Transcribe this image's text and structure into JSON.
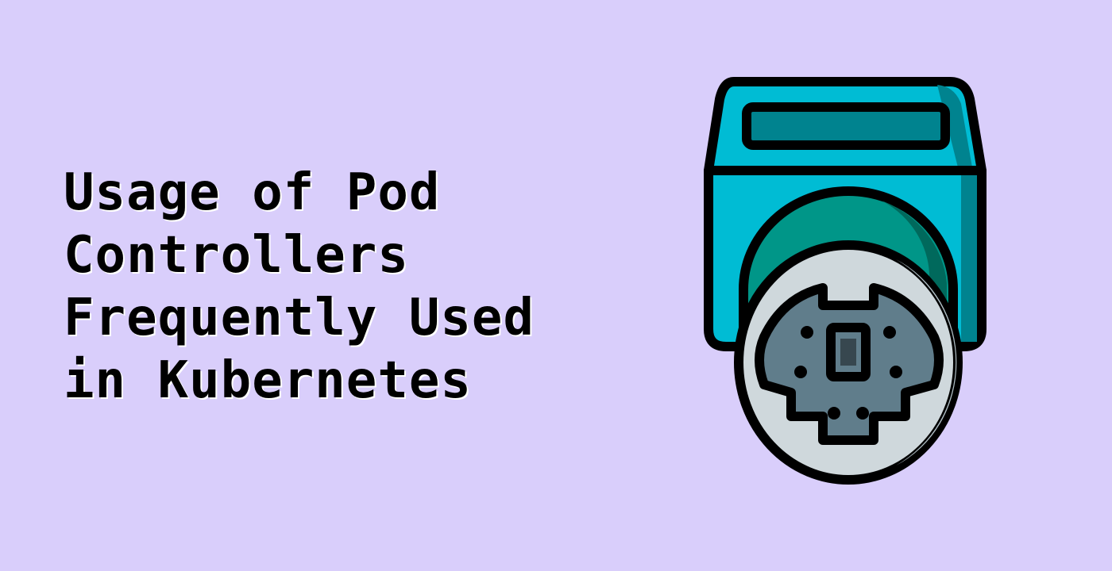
{
  "title": {
    "lines": [
      "Usage of Pod",
      "Controllers",
      "Frequently Used",
      "in Kubernetes"
    ]
  },
  "illustration": {
    "icon": "pod-socket-icon"
  },
  "colors": {
    "background": "#d9cefb",
    "text": "#000000",
    "text_shadow": "#ffffff",
    "outline": "#000000",
    "box_cyan": "#00bcd4",
    "box_dark": "#00838f",
    "window_teal": "#00838f",
    "dome_green": "#009688",
    "dome_shadow": "#00695c",
    "plate_light": "#cfd8dc",
    "plate_shadow": "#b0bec5",
    "socket_gray": "#607d8b",
    "socket_slot": "#37474f"
  }
}
